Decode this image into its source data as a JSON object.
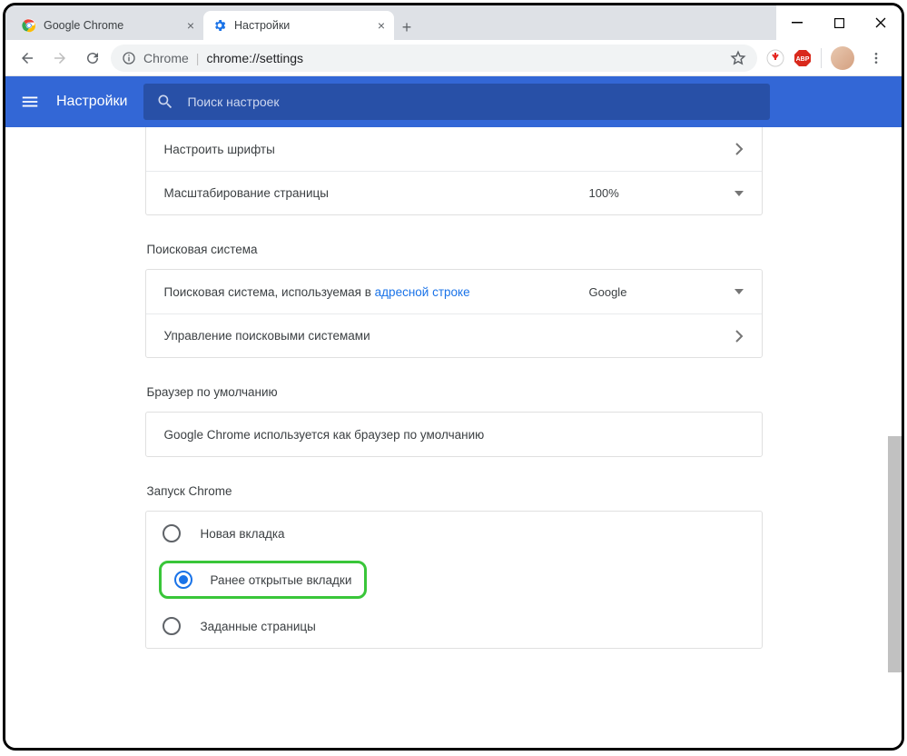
{
  "window": {
    "tabs": [
      {
        "title": "Google Chrome",
        "active": false
      },
      {
        "title": "Настройки",
        "active": true
      }
    ]
  },
  "addressbar": {
    "host": "Chrome",
    "path": "chrome://settings"
  },
  "header": {
    "title": "Настройки",
    "search_placeholder": "Поиск настроек"
  },
  "sections": {
    "appearance": {
      "rows": {
        "fonts": {
          "label": "Настроить шрифты"
        },
        "zoom": {
          "label": "Масштабирование страницы",
          "value": "100%"
        }
      }
    },
    "search_engine": {
      "title": "Поисковая система",
      "rows": {
        "default": {
          "label_prefix": "Поисковая система, используемая в ",
          "link": "адресной строке",
          "value": "Google"
        },
        "manage": {
          "label": "Управление поисковыми системами"
        }
      }
    },
    "default_browser": {
      "title": "Браузер по умолчанию",
      "row": {
        "label": "Google Chrome используется как браузер по умолчанию"
      }
    },
    "on_startup": {
      "title": "Запуск Chrome",
      "options": [
        {
          "label": "Новая вкладка",
          "selected": false
        },
        {
          "label": "Ранее открытые вкладки",
          "selected": true
        },
        {
          "label": "Заданные страницы",
          "selected": false
        }
      ]
    }
  }
}
